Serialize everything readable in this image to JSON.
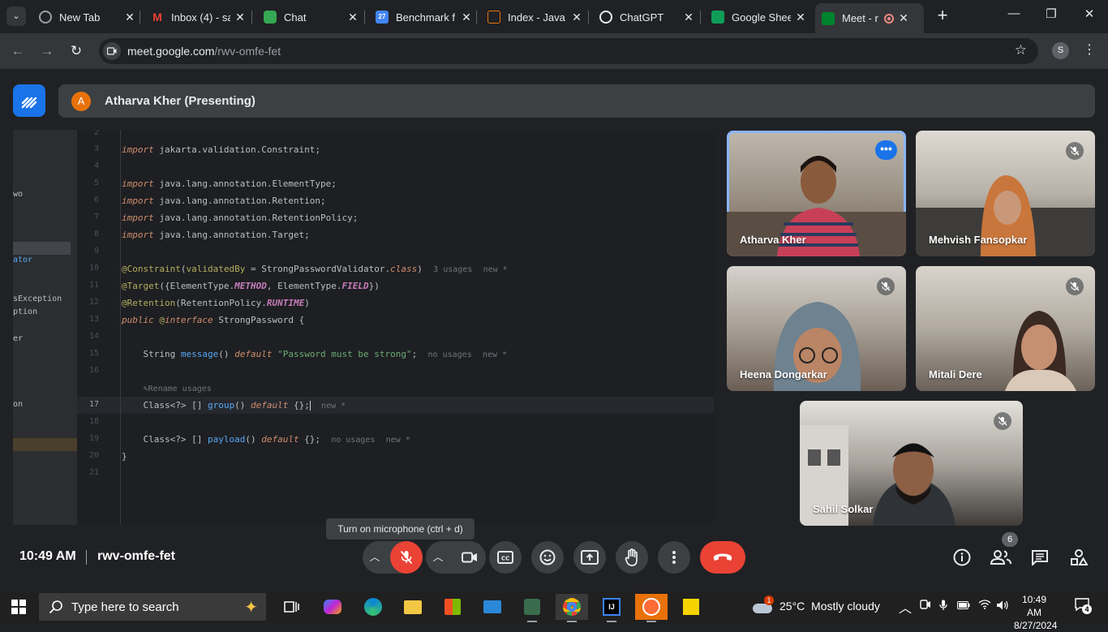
{
  "browser": {
    "tabs": [
      {
        "title": "New Tab",
        "favicon": "chrome-icon"
      },
      {
        "title": "Inbox (4) - sa",
        "favicon": "gmail-icon"
      },
      {
        "title": "Chat",
        "favicon": "google-chat-icon"
      },
      {
        "title": "Benchmark f",
        "favicon": "calendar-icon"
      },
      {
        "title": "Index - Java",
        "favicon": "javadoc-icon"
      },
      {
        "title": "ChatGPT",
        "favicon": "chatgpt-icon"
      },
      {
        "title": "Google Shee",
        "favicon": "sheets-icon"
      },
      {
        "title": "Meet - r",
        "favicon": "meet-icon",
        "active": true
      }
    ],
    "url_host": "meet.google.com",
    "url_path": "/rwv-omfe-fet",
    "profile_initial": "S"
  },
  "meet": {
    "presenter_initial": "A",
    "presenter_label": "Atharva Kher (Presenting)",
    "participants": [
      {
        "name": "Atharva Kher",
        "muted": false,
        "active_speaker": true
      },
      {
        "name": "Mehvish Fansopkar",
        "muted": true
      },
      {
        "name": "Heena Dongarkar",
        "muted": true
      },
      {
        "name": "Mitali Dere",
        "muted": true
      },
      {
        "name": "Sahil Solkar",
        "muted": true
      }
    ],
    "tooltip": "Turn on microphone (ctrl + d)",
    "time": "10:49 AM",
    "meeting_code": "rwv-omfe-fet",
    "people_count": "6",
    "accent": "#1a73e8",
    "end_call_color": "#ea4335"
  },
  "ide": {
    "project_items": [
      "wo",
      "ator",
      "sException",
      "ption",
      "er",
      "on"
    ],
    "line_numbers": [
      "2",
      "3",
      "4",
      "5",
      "6",
      "7",
      "8",
      "9",
      "10",
      "11",
      "12",
      "13",
      "14",
      "15",
      "16",
      "",
      "17",
      "18",
      "19",
      "20",
      "21"
    ],
    "hints": {
      "usages3": "3 usages",
      "new": "new *",
      "no_usages": "no usages",
      "rename": "Rename usages"
    }
  },
  "taskbar": {
    "search_placeholder": "Type here to search",
    "weather": "25°C  Mostly cloudy",
    "weather_alert": "1",
    "time": "10:49 AM",
    "date": "8/27/2024",
    "notifications": "4"
  }
}
